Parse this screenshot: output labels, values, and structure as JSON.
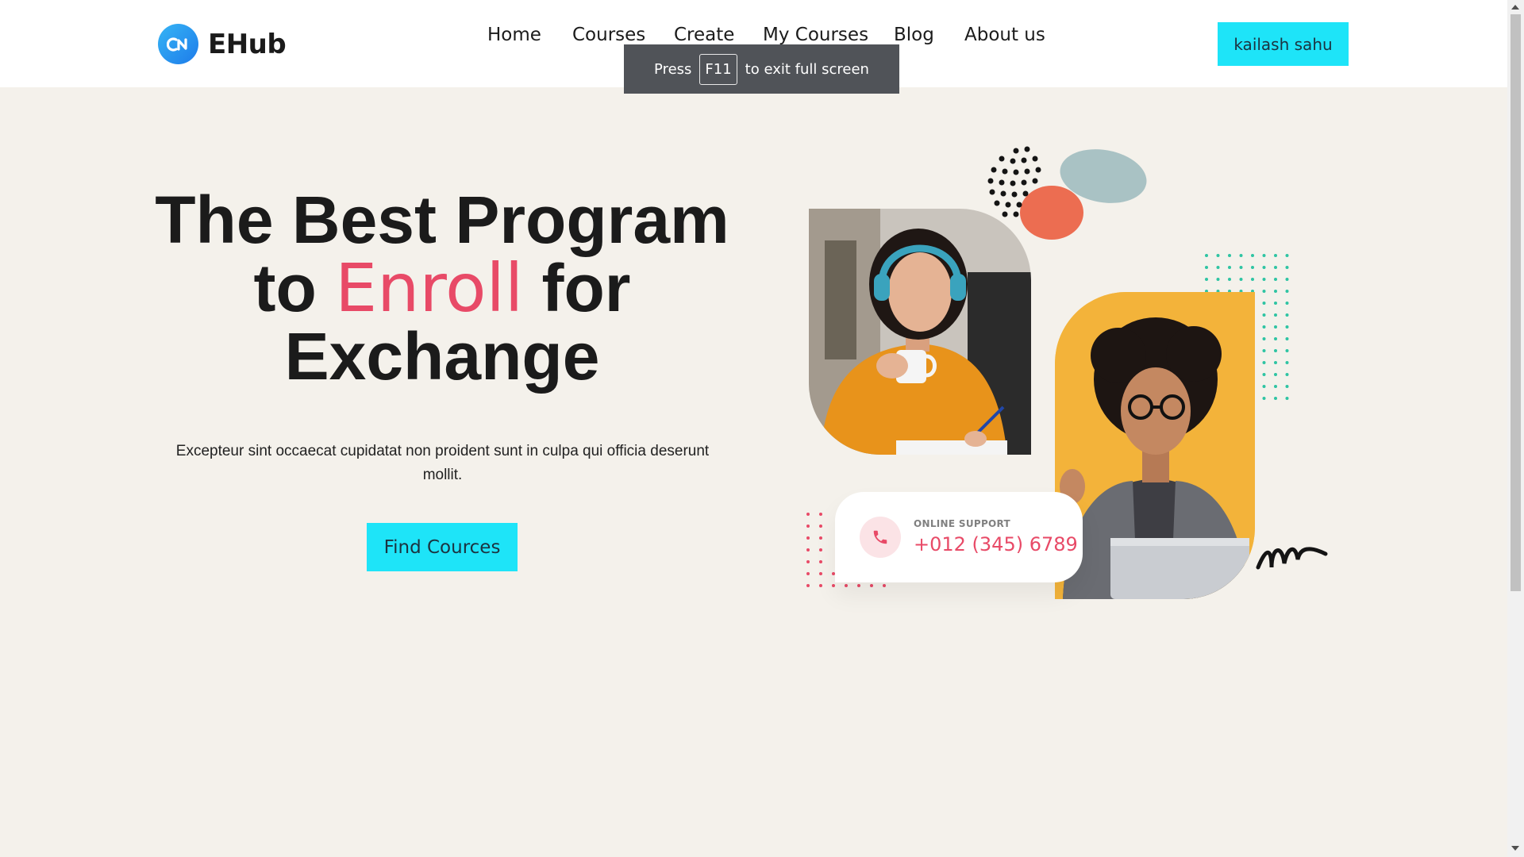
{
  "brand": {
    "name": "EHub"
  },
  "nav": {
    "items": [
      {
        "label": "Home"
      },
      {
        "label": "Courses"
      },
      {
        "label": "Create"
      },
      {
        "label": "My Courses"
      },
      {
        "label": "Blog"
      },
      {
        "label": "About us"
      }
    ]
  },
  "user": {
    "name": "kailash sahu"
  },
  "fullscreen_toast": {
    "prefix": "Press",
    "key": "F11",
    "suffix": "to exit full screen"
  },
  "hero": {
    "title_line1": "The Best Program",
    "title_to": "to ",
    "title_accent": "Enroll",
    "title_for": " for",
    "title_line3": "Exchange",
    "subtitle": "Excepteur sint occaecat cupidatat non proident sunt in culpa qui officia deserunt mollit.",
    "cta_label": "Find Cources"
  },
  "support": {
    "label": "ONLINE SUPPORT",
    "phone": "+012 (345) 6789"
  },
  "colors": {
    "accent": "#1ee4f8",
    "highlight": "#e84a67",
    "background": "#f4f1eb",
    "header": "#ffffff"
  },
  "icons": {
    "logo": "ehub-logo-icon",
    "phone": "phone-icon"
  }
}
